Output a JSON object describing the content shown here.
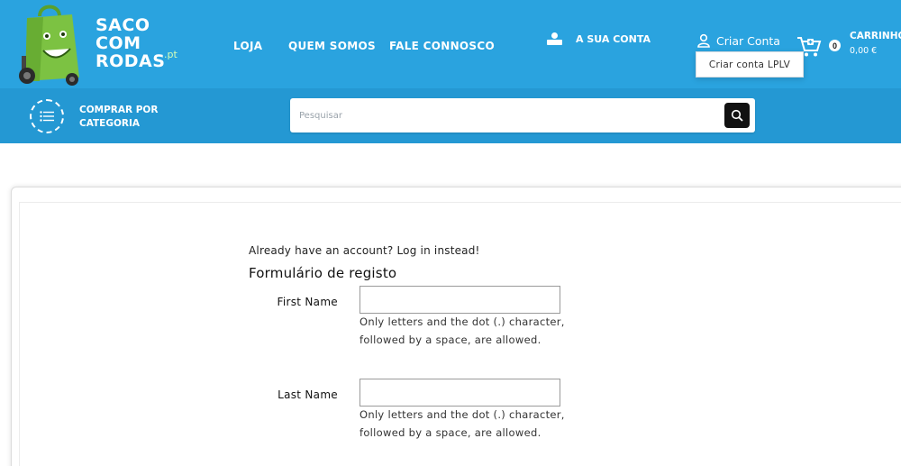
{
  "header": {
    "logo_words": [
      "SACO",
      "COM",
      "RODAS"
    ],
    "logo_suffix": ".pt",
    "nav": [
      {
        "label": "LOJA"
      },
      {
        "label": "QUEM SOMOS"
      },
      {
        "label": "FALE CONNOSCO"
      }
    ],
    "account_label": "A SUA CONTA",
    "criar_conta_label": "Criar Conta",
    "dropdown_item": "Criar conta LPLV",
    "cart": {
      "count": "0",
      "label": "CARRINHO",
      "amount": "0,00 €"
    }
  },
  "subheader": {
    "category_label": "COMPRAR POR CATEGORIA",
    "search_placeholder": "Pesquisar"
  },
  "form": {
    "already_text": "Already have an account? Log in instead!",
    "title": "Formulário de registo",
    "fields": [
      {
        "label": "First Name",
        "value": "",
        "hint": "Only letters and the dot (.) character, followed by a space, are allowed."
      },
      {
        "label": "Last Name",
        "value": "",
        "hint": "Only letters and the dot (.) character, followed by a space, are allowed."
      }
    ]
  },
  "colors": {
    "header_blue": "#2aa3df",
    "subbar_blue": "#2498d3",
    "logo_green": "#7cc242"
  },
  "icons": [
    "shopping-bag-logo-icon",
    "account-card-icon",
    "user-icon",
    "cart-icon",
    "category-list-icon",
    "search-icon"
  ]
}
